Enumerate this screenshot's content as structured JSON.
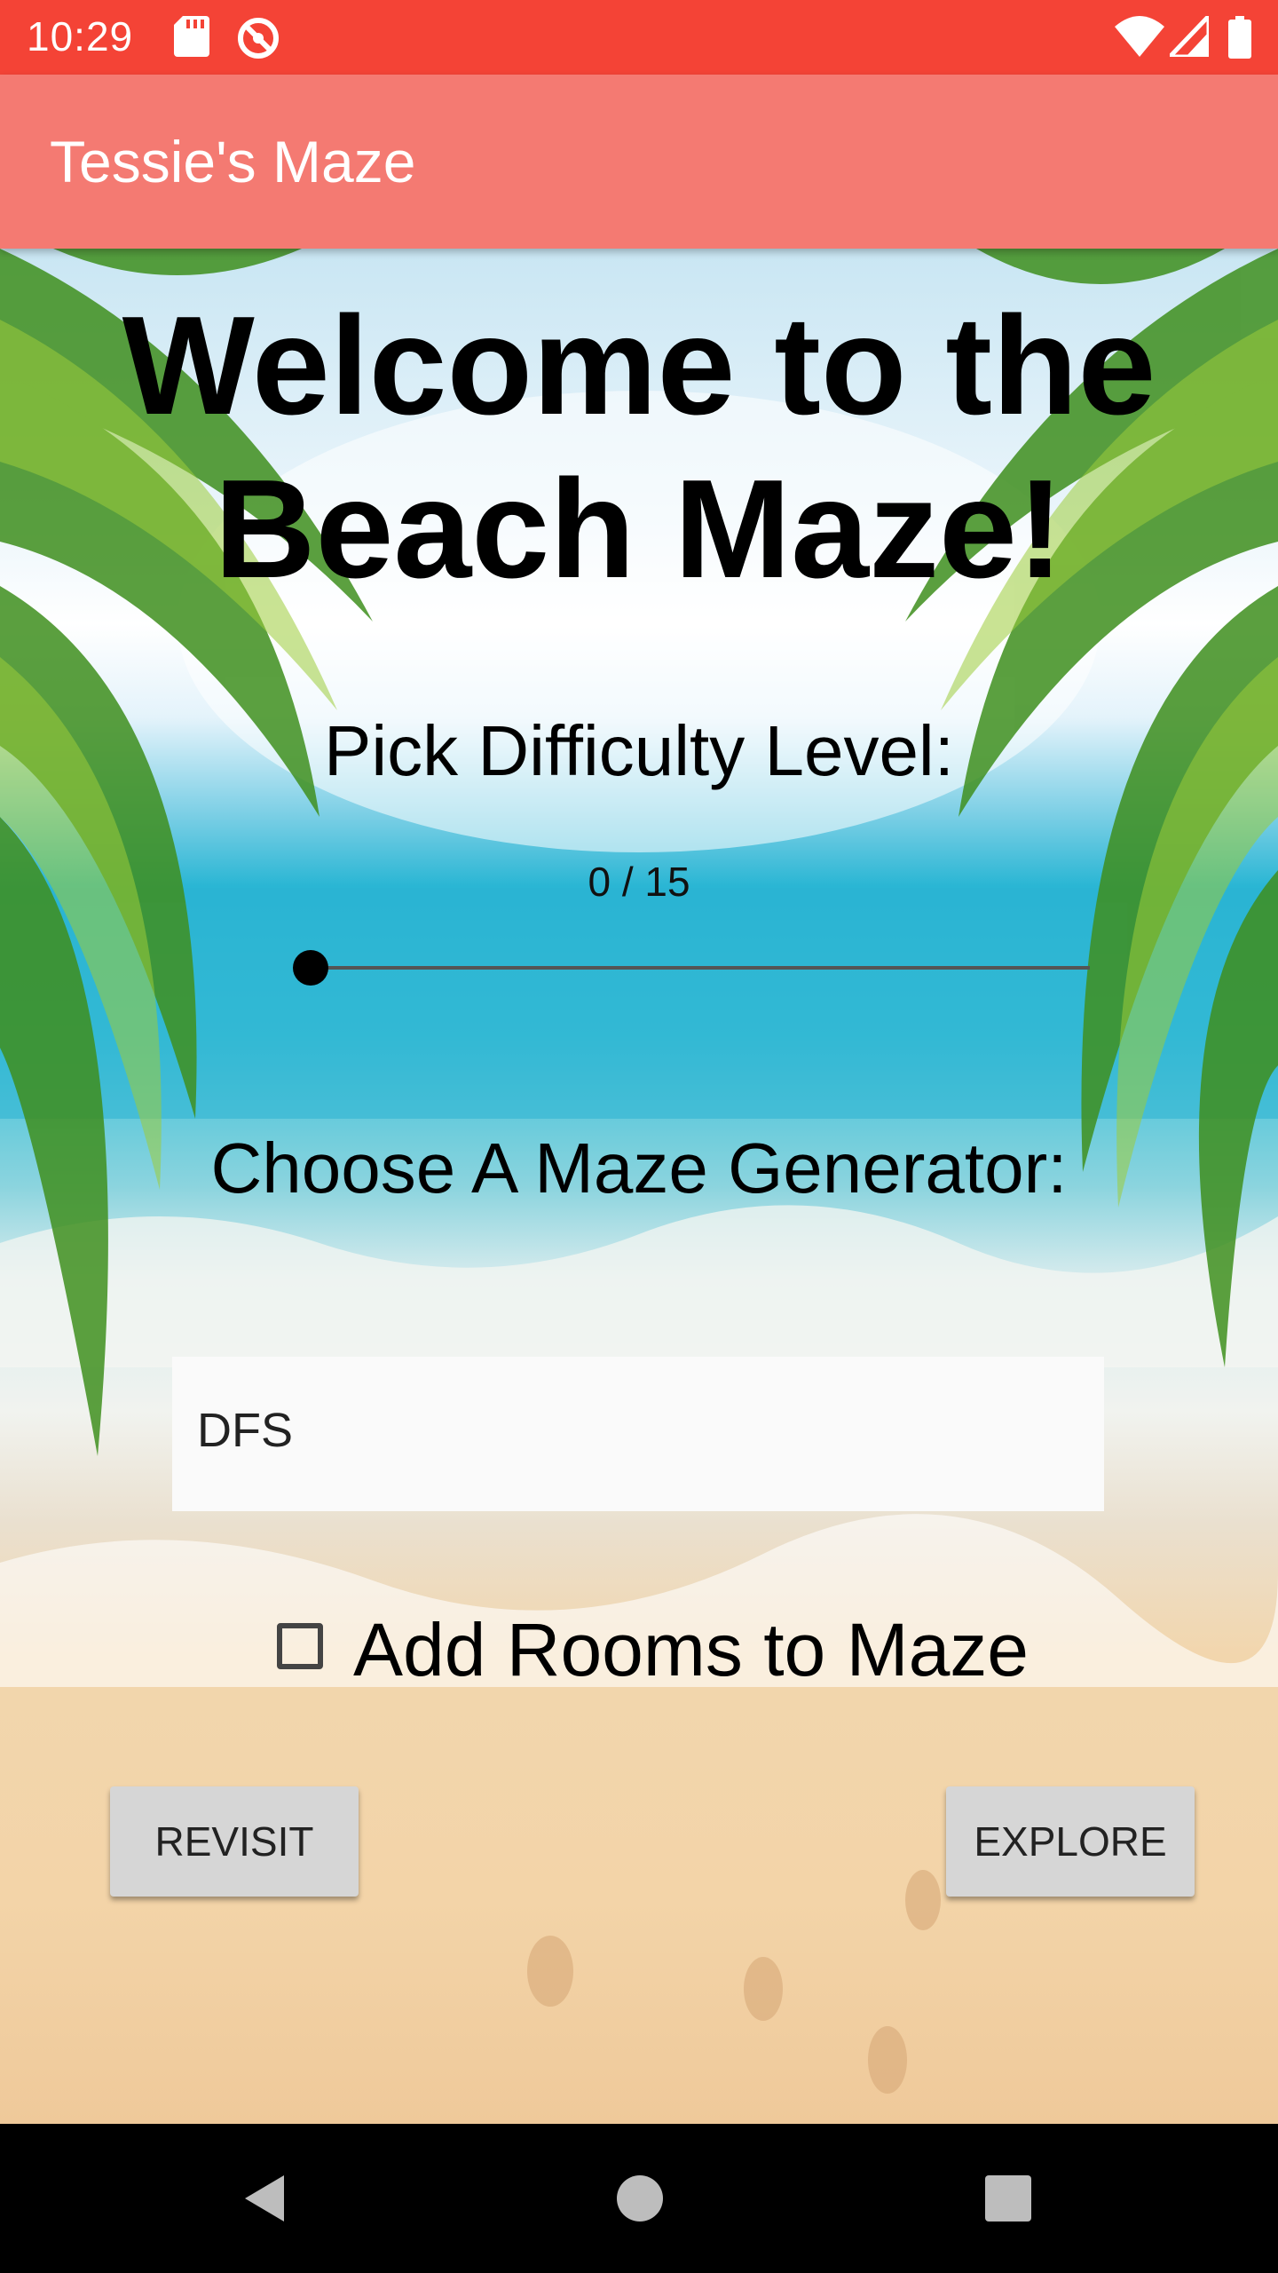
{
  "status_bar": {
    "time": "10:29",
    "icons": [
      "sd-card-icon",
      "sync-disabled-icon",
      "wifi-icon",
      "signal-icon",
      "battery-icon"
    ]
  },
  "app_bar": {
    "title": "Tessie's Maze"
  },
  "main": {
    "welcome_line1": "Welcome to the",
    "welcome_line2": "Beach Maze!",
    "difficulty_label": "Pick Difficulty Level:",
    "difficulty_value": "0 / 15",
    "difficulty_fraction": 0,
    "generator_label": "Choose A Maze Generator:",
    "generator_selected": "DFS",
    "rooms_label": "Add Rooms to Maze",
    "rooms_checked": false,
    "revisit_label": "REVISIT",
    "explore_label": "EXPLORE"
  },
  "nav_bar": {
    "icons": [
      "back-icon",
      "home-icon",
      "recents-icon"
    ]
  },
  "colors": {
    "status_bar": "#f44336",
    "app_bar": "#f47a72",
    "button": "#d6d6d6",
    "spinner_bg": "#fafafa"
  }
}
